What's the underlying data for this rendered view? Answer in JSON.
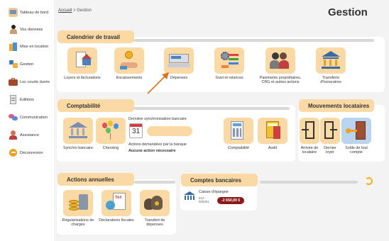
{
  "sidebar": {
    "items": [
      {
        "label": "Tableau de bord",
        "icon": "dashboard-icon"
      },
      {
        "label": "Vos données",
        "icon": "user-icon"
      },
      {
        "label": "Mise en location",
        "icon": "building-icon"
      },
      {
        "label": "Gestion",
        "icon": "management-icon"
      },
      {
        "label": "Loc courte durée",
        "icon": "suitcase-icon"
      },
      {
        "label": "Editions",
        "icon": "document-icon"
      },
      {
        "label": "Communication",
        "icon": "chat-icon"
      },
      {
        "label": "Assistance",
        "icon": "support-icon"
      },
      {
        "label": "Déconnexion",
        "icon": "logout-icon"
      }
    ]
  },
  "breadcrumb": {
    "home": "Accueil",
    "separator": ">",
    "current": "Gestion"
  },
  "page_title": "Gestion",
  "calendrier": {
    "title": "Calendrier de travail",
    "tiles": [
      {
        "label": "Loyers et facturations",
        "icon": "invoice-house-icon"
      },
      {
        "label": "Encaissements",
        "icon": "coin-hand-icon"
      },
      {
        "label": "Dépenses",
        "icon": "cash-register-icon"
      },
      {
        "label": "Suivi et relances",
        "icon": "gear-checklist-icon"
      },
      {
        "label": "Paiements propriétaires, CRG et autres actions",
        "icon": "people-icon"
      },
      {
        "label": "Transferts d'honoraires",
        "icon": "bank-transfer-icon"
      }
    ]
  },
  "comptabilite": {
    "title": "Comptabilité",
    "tiles": [
      {
        "label": "Synchro bancaire",
        "icon": "bank-sync-icon"
      },
      {
        "label": "Checking",
        "icon": "balloons-icon"
      },
      {
        "label": "Comptabilité",
        "icon": "calculator-icon"
      },
      {
        "label": "Audit",
        "icon": "audit-folder-icon"
      }
    ],
    "last_sync_label": "Dernière synchronisation bancaire",
    "calendar_day": "31",
    "pending_label": "Actions demandées par la banque",
    "pending_value": "Aucune action nécessaire"
  },
  "mouvements": {
    "title": "Mouvements locataires",
    "tiles": [
      {
        "label": "Arrivée de locataire",
        "icon": "door-in-icon"
      },
      {
        "label": "Dernier loyer",
        "icon": "door-out-icon"
      },
      {
        "label": "Solde de tout compte",
        "icon": "key-door-icon"
      }
    ]
  },
  "actions": {
    "title": "Actions annuelles",
    "tiles": [
      {
        "label": "Régularisations de charges",
        "icon": "coins-calculator-icon"
      },
      {
        "label": "Déclarations fiscales",
        "icon": "tax-icon"
      },
      {
        "label": "Transfert de dépenses",
        "icon": "money-bags-icon"
      }
    ]
  },
  "comptes": {
    "title": "Comptes bancaires",
    "account_name": "Caisse d'épargne",
    "account_number": "512-000001",
    "amount": "-2 650,00 €",
    "refresh_icon": "refresh-icon"
  },
  "colors": {
    "accent": "#fbd9a4",
    "negative_badge": "#8b1a1a",
    "arrow": "#e2701f"
  }
}
